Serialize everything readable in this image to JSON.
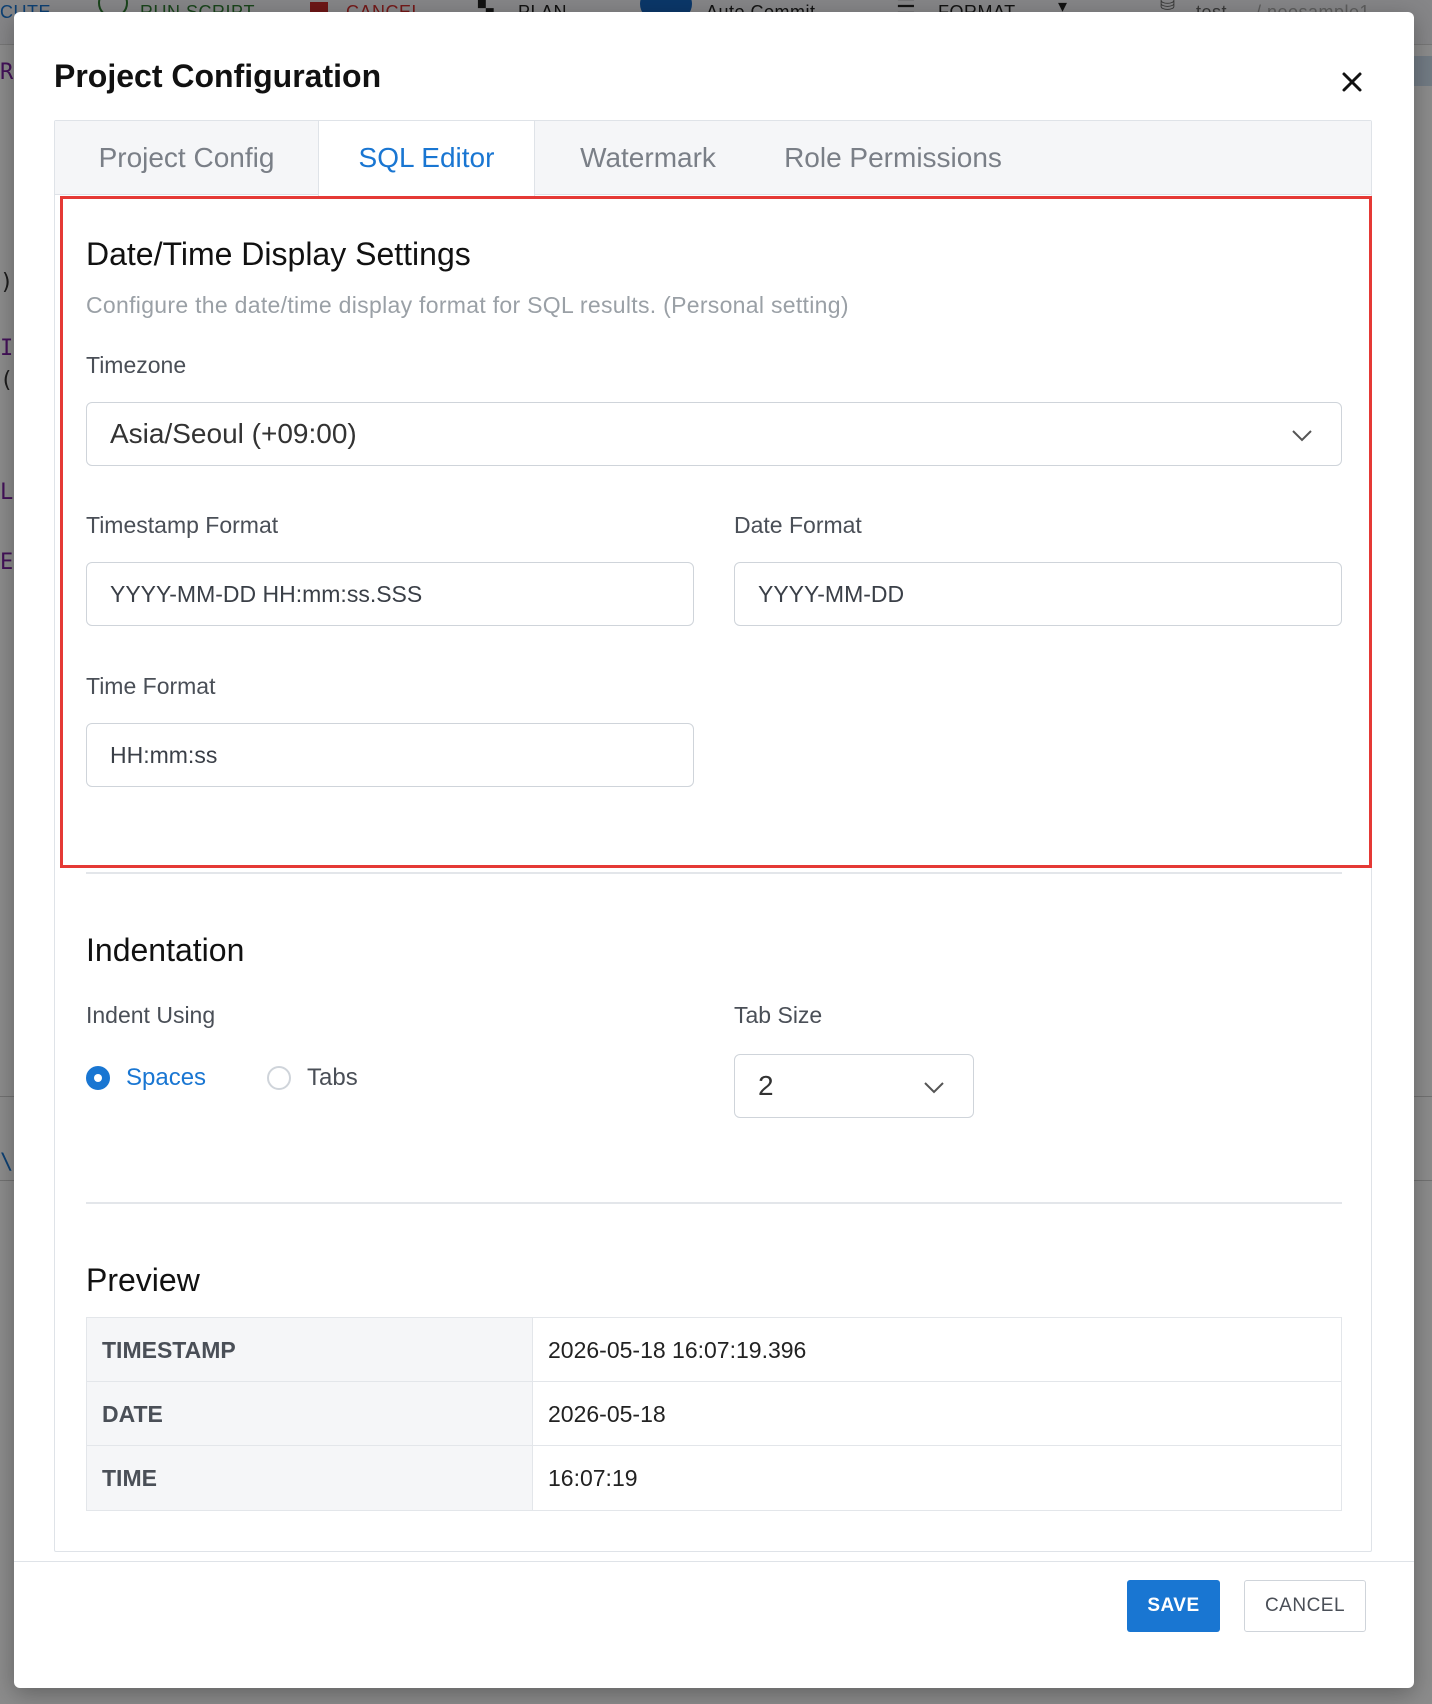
{
  "background": {
    "toolbar": {
      "execute_label": "CUTE",
      "run_script_label": "RUN SCRIPT",
      "cancel_label": "CANCEL",
      "plan_label": "PLAN",
      "auto_commit_label": "Auto Commit",
      "format_label": "FORMAT",
      "db_label": "test",
      "schema_label": "/ neosample1"
    },
    "editor_fragments": [
      "RE",
      ") ,",
      "IN",
      "(",
      "LE",
      "EL",
      "\\"
    ]
  },
  "modal": {
    "title": "Project Configuration",
    "close_icon": "close-icon",
    "tabs": [
      {
        "label": "Project Config",
        "active": false
      },
      {
        "label": "SQL Editor",
        "active": true
      },
      {
        "label": "Watermark",
        "active": false
      },
      {
        "label": "Role Permissions",
        "active": false
      }
    ],
    "datetime": {
      "title": "Date/Time Display Settings",
      "description": "Configure the date/time display format for SQL results. (Personal setting)",
      "timezone_label": "Timezone",
      "timezone_value": "Asia/Seoul (+09:00)",
      "timestamp_format_label": "Timestamp Format",
      "timestamp_format_value": "YYYY-MM-DD HH:mm:ss.SSS",
      "date_format_label": "Date Format",
      "date_format_value": "YYYY-MM-DD",
      "time_format_label": "Time Format",
      "time_format_value": "HH:mm:ss"
    },
    "indentation": {
      "title": "Indentation",
      "indent_using_label": "Indent Using",
      "options": [
        {
          "label": "Spaces",
          "checked": true
        },
        {
          "label": "Tabs",
          "checked": false
        }
      ],
      "tab_size_label": "Tab Size",
      "tab_size_value": "2"
    },
    "preview": {
      "title": "Preview",
      "rows": [
        {
          "key": "TIMESTAMP",
          "value": "2026-05-18 16:07:19.396"
        },
        {
          "key": "DATE",
          "value": "2026-05-18"
        },
        {
          "key": "TIME",
          "value": "16:07:19"
        }
      ]
    },
    "footer": {
      "save_label": "SAVE",
      "cancel_label": "CANCEL"
    }
  },
  "colors": {
    "accent": "#1976d2",
    "highlight_border": "#e53935"
  }
}
